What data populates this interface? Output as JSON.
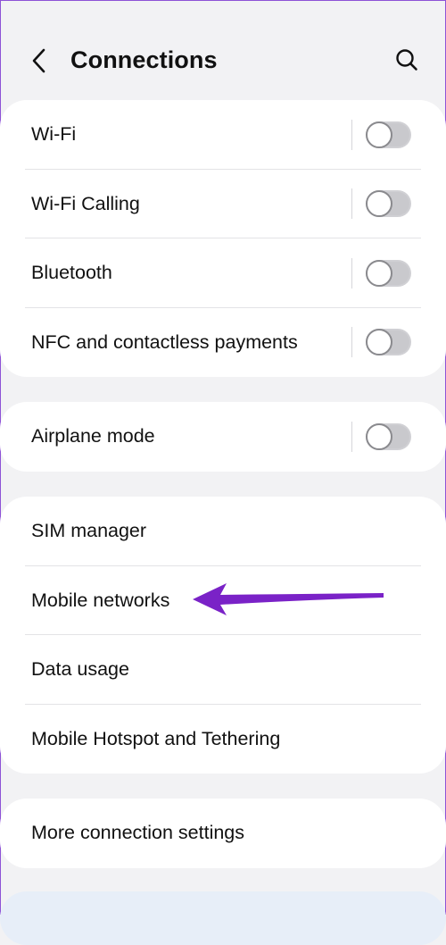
{
  "header": {
    "title": "Connections",
    "back_icon": "chevron-left-icon",
    "search_icon": "search-icon"
  },
  "groups": [
    {
      "items": [
        {
          "label": "Wi-Fi",
          "has_toggle": true,
          "toggle_on": false
        },
        {
          "label": "Wi-Fi Calling",
          "has_toggle": true,
          "toggle_on": false
        },
        {
          "label": "Bluetooth",
          "has_toggle": true,
          "toggle_on": false
        },
        {
          "label": "NFC and contactless payments",
          "has_toggle": true,
          "toggle_on": false
        }
      ]
    },
    {
      "items": [
        {
          "label": "Airplane mode",
          "has_toggle": true,
          "toggle_on": false
        }
      ]
    },
    {
      "items": [
        {
          "label": "SIM manager"
        },
        {
          "label": "Mobile networks"
        },
        {
          "label": "Data usage"
        },
        {
          "label": "Mobile Hotspot and Tethering"
        }
      ]
    },
    {
      "items": [
        {
          "label": "More connection settings"
        }
      ]
    }
  ],
  "annotation": {
    "type": "arrow",
    "points_to": "Mobile networks",
    "color": "#7a22c7"
  },
  "colors": {
    "background": "#f2f2f4",
    "card": "#ffffff",
    "text": "#111111",
    "divider": "#e3e3e6",
    "toggle_off_track": "#c9c9cd",
    "toggle_off_knob_border": "#8a8a8e"
  }
}
